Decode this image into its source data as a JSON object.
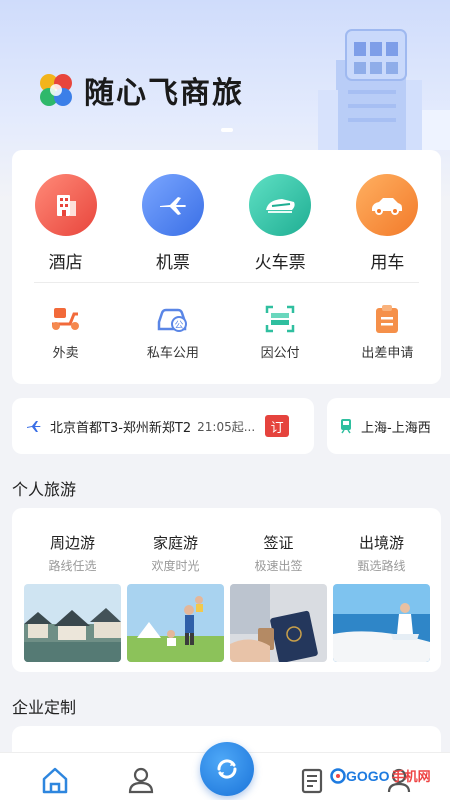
{
  "app": {
    "title": "随心飞商旅"
  },
  "services": {
    "main": [
      {
        "label": "酒店",
        "icon": "hotel-icon",
        "color": "#f0625a"
      },
      {
        "label": "机票",
        "icon": "airplane-icon",
        "color": "#4b7ff2"
      },
      {
        "label": "火车票",
        "icon": "train-icon",
        "color": "#2fc0a4"
      },
      {
        "label": "用车",
        "icon": "car-icon",
        "color": "#f68a3d"
      }
    ],
    "secondary": [
      {
        "label": "外卖",
        "icon": "scooter-icon"
      },
      {
        "label": "私车公用",
        "icon": "private-car-icon"
      },
      {
        "label": "因公付",
        "icon": "scan-pay-icon"
      },
      {
        "label": "出差申请",
        "icon": "clipboard-icon"
      }
    ]
  },
  "trips": [
    {
      "route": "北京首都T3-郑州新郑T2",
      "time": "21:05起...",
      "badge": "订",
      "icon": "flight-icon"
    },
    {
      "route": "上海-上海西",
      "icon": "train-icon"
    }
  ],
  "sections": {
    "personal_travel": "个人旅游",
    "enterprise": "企业定制"
  },
  "travel": [
    {
      "title": "周边游",
      "subtitle": "路线任选"
    },
    {
      "title": "家庭游",
      "subtitle": "欢度时光"
    },
    {
      "title": "签证",
      "subtitle": "极速出签"
    },
    {
      "title": "出境游",
      "subtitle": "甄选路线"
    }
  ],
  "tabbar": {
    "items": [
      "home-icon",
      "user-icon",
      "center-action-icon",
      "orders-icon",
      "profile-icon"
    ]
  },
  "watermark": {
    "text": "GOGO",
    "suffix": "手机网"
  }
}
